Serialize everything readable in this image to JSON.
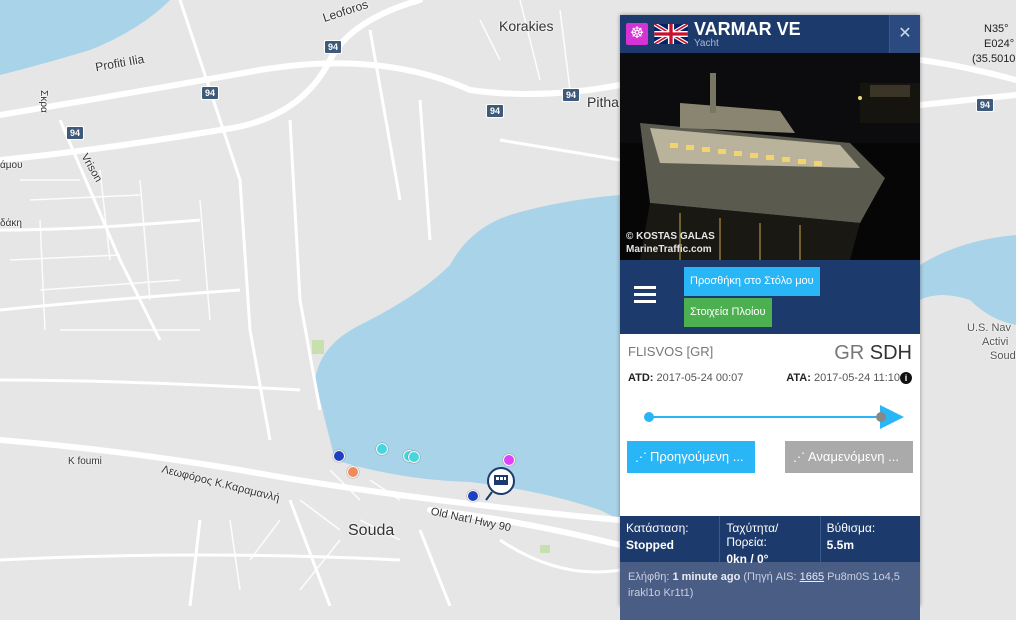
{
  "map": {
    "labels": {
      "leoforos": "Leoforos",
      "korakies": "Korakies",
      "profiti_ilia": "Profiti Ilia",
      "pitha": "Pitha",
      "skra": "Σκρα",
      "amou": "άμου",
      "vrison": "Vrison",
      "daki": "δάκη",
      "usnav": "U.S. Nav",
      "activi": "Activi",
      "soud": "Soud",
      "kfoumi": "K foumi",
      "karamanli": "Λεωφόρος Κ.Καραμανλή",
      "old_hwy": "Old Nat'l Hwy 90",
      "souda": "Souda"
    },
    "road_shield": "94",
    "coords": [
      "N35°",
      "E024°",
      "(35.5010"
    ]
  },
  "vessel": {
    "name": "VARMAR VE",
    "type": "Yacht",
    "type_icon": "ship-wheel-icon",
    "flag": "uk-flag-icon",
    "photo_credit_line1": "© KOSTAS GALAS",
    "photo_credit_line2": "MarineTraffic.com"
  },
  "actions": {
    "add_fleet": "Προσθήκη στο Στόλο μου",
    "vessel_details": "Στοιχεία Πλοίου"
  },
  "voyage": {
    "departure_port": "FLISVOS [GR]",
    "arrival_cc": "GR",
    "arrival_code": "SDH",
    "atd_label": "ATD:",
    "atd_value": "2017-05-24 00:07",
    "ata_label": "ATA:",
    "ata_value": "2017-05-24 11:10",
    "progress": 0.91,
    "prev_button": "Προηγούμενη ...",
    "next_button": "Αναμενόμενη ..."
  },
  "status": {
    "state_label": "Κατάσταση:",
    "state_value": "Stopped",
    "speed_label": "Ταχύτητα/Πορεία:",
    "speed_value": "0kn / 0°",
    "draught_label": "Βύθισμα:",
    "draught_value": "5.5m"
  },
  "received": {
    "label": "Ελήφθη:",
    "value": "1 minute ago",
    "source_prefix": "(Πηγή AIS:",
    "source_id": "1665",
    "source_suffix": "Pu8m0S 1o4,5 irakl1o Kr1t1)"
  },
  "colors": {
    "sea": "#a9d3e8",
    "land": "#e6e6e6",
    "road": "#ffffff",
    "panel_header": "#1c3a6b",
    "accent_blue": "#29b6f6",
    "accent_green": "#4caf50"
  }
}
